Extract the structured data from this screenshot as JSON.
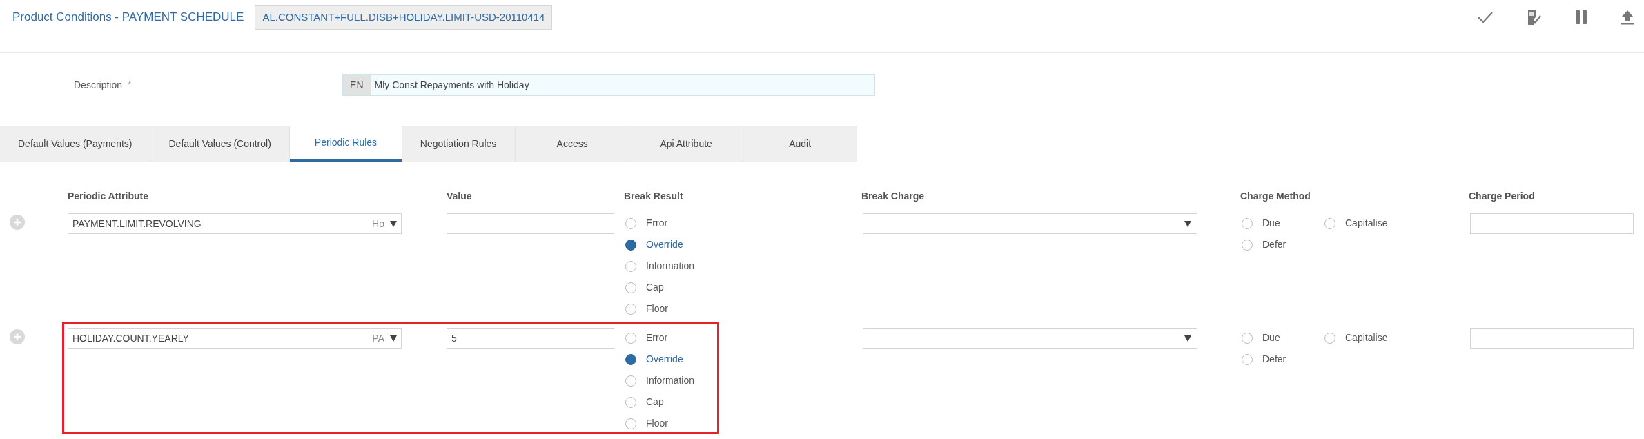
{
  "header": {
    "title": "Product Conditions - PAYMENT SCHEDULE",
    "record_id": "AL.CONSTANT+FULL.DISB+HOLIDAY.LIMIT-USD-20110414"
  },
  "description": {
    "label": "Description",
    "required_mark": "*",
    "language": "EN",
    "value": "Mly Const Repayments with Holiday"
  },
  "tabs": [
    {
      "label": "Default Values (Payments)",
      "selected": false
    },
    {
      "label": "Default Values (Control)",
      "selected": false
    },
    {
      "label": "Periodic Rules",
      "selected": true
    },
    {
      "label": "Negotiation Rules",
      "selected": false
    },
    {
      "label": "Access",
      "selected": false
    },
    {
      "label": "Api Attribute",
      "selected": false
    },
    {
      "label": "Audit",
      "selected": false
    }
  ],
  "columns": [
    "Periodic Attribute",
    "Value",
    "Break Result",
    "Break Charge",
    "Charge Method",
    "Charge Period"
  ],
  "rows": [
    {
      "attribute": "PAYMENT.LIMIT.REVOLVING",
      "attribute_suffix": "Ho",
      "highlighted": false,
      "break_result": [
        {
          "label": "Error",
          "selected": false
        },
        {
          "label": "Override",
          "selected": true
        },
        {
          "label": "Information",
          "selected": false
        },
        {
          "label": "Cap",
          "selected": false
        },
        {
          "label": "Floor",
          "selected": false
        }
      ],
      "charge_method": [
        {
          "label": "Due",
          "selected": false
        },
        {
          "label": "Capitalise",
          "selected": false
        },
        {
          "label": "Defer",
          "selected": false
        }
      ]
    },
    {
      "attribute": "HOLIDAY.COUNT.YEARLY",
      "attribute_suffix": "PA",
      "value": "5",
      "highlighted": true,
      "break_result": [
        {
          "label": "Error",
          "selected": false
        },
        {
          "label": "Override",
          "selected": true
        },
        {
          "label": "Information",
          "selected": false
        },
        {
          "label": "Cap",
          "selected": false
        },
        {
          "label": "Floor",
          "selected": false
        }
      ],
      "charge_method": [
        {
          "label": "Due",
          "selected": false
        },
        {
          "label": "Capitalise",
          "selected": false
        },
        {
          "label": "Defer",
          "selected": false
        }
      ]
    }
  ]
}
